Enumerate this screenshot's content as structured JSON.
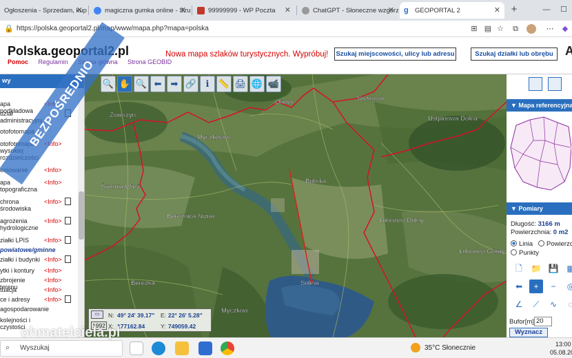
{
  "browser": {
    "tabs": [
      {
        "title": "Ogłoszenia - Sprzedam, kupię -",
        "color": "#2a6fbf"
      },
      {
        "title": "magiczna gumka online - Szuk",
        "color": "#4285f4"
      },
      {
        "title": "99999999 - WP Poczta",
        "color": "#c0392b"
      },
      {
        "title": "ChatGPT - Słoneczne wzgórze",
        "color": "#888888"
      },
      {
        "title": "GEOPORTAL 2",
        "color": "#2a6fbf"
      }
    ],
    "url": "https://polska.geoportal2.pl/map/www/mapa.php?mapa=polska"
  },
  "site": {
    "logo": "Polska.geoportal2.pl",
    "links": [
      "Pomoc",
      "Regulamin",
      "Strona główna",
      "Strona GEOBID"
    ],
    "promo": "Nowa mapa szlaków turystycznych. Wypróbuj!",
    "search_place_btn": "Szukaj miejscowości, ulicy lub adresu",
    "search_parcel_btn": "Szukaj działki lub obrębu"
  },
  "left_panel": {
    "header": "wy",
    "layers": [
      {
        "name": "apa podkładowa",
        "info": "<Info>",
        "doc": false
      },
      {
        "name": "dział administracyjny",
        "info": "",
        "doc": true
      },
      {
        "name": "otofotomapa",
        "info": "",
        "doc": false
      },
      {
        "name": "otofotomapa wysokiej rozdzielczości",
        "info": "<Info>",
        "doc": false
      },
      {
        "name": "eniowanie",
        "info": "<Info>",
        "doc": false
      },
      {
        "name": "apa topograficzna",
        "info": "<Info>",
        "doc": false
      },
      {
        "name": "chrona środowiska",
        "info": "<Info>",
        "doc": true
      },
      {
        "name": "agrożenia hydrologiczne",
        "info": "<Info>",
        "doc": true
      },
      {
        "name": "ziałki LPIS",
        "info": "<Info>",
        "doc": true
      },
      {
        "name": "powiatowe/gminne",
        "info": "",
        "doc": false
      },
      {
        "name": "ziałki i budynki",
        "info": "<Info>",
        "doc": true
      },
      {
        "name": "ytki i kontury",
        "info": "<Info>",
        "doc": false
      },
      {
        "name": "zbrojenie terenu",
        "info": "<Info>",
        "doc": false
      },
      {
        "name": "tuacja",
        "info": "<Info>",
        "doc": false
      },
      {
        "name": "ce i adresy",
        "info": "<Info>",
        "doc": true
      },
      {
        "name": "agospodarowanie",
        "info": "",
        "doc": false
      },
      {
        "name": "kolejności i czystości",
        "info": "",
        "doc": false
      }
    ]
  },
  "map": {
    "places": [
      "Zwierzyń",
      "Orelec",
      "Stefkowa",
      "Ustjanowa Dolna",
      "Myczkowce",
      "Bóbrka",
      "Średnia Wieś",
      "Bereżnica Niżna",
      "Łobozew Dolny",
      "Łobozew Górny",
      "Berezka",
      "Solina",
      "Myczków"
    ],
    "coords": {
      "n_label": "N:",
      "n_val": "49° 24' 39.17\"",
      "e_label": "E:",
      "e_val": "22° 26' 5.28\"",
      "x_label": "X:",
      "x_val": "177162.84",
      "y_label": "Y:",
      "y_val": "749059.42",
      "year": "1992"
    }
  },
  "right_panel": {
    "ref_header": "Mapa referencyjna",
    "meas_header": "Pomiary",
    "length_label": "Długość:",
    "length_val": "3166 m",
    "area_label": "Powierzchnia:",
    "area_val": "0 m2",
    "mode_line": "Linia",
    "mode_area": "Powierzchnia",
    "mode_points": "Punkty",
    "buffer_label": "Bufor[m]",
    "buffer_val": "20",
    "show_btn": "Wyznacz"
  },
  "overlays": {
    "ribbon": "BEZPOŚREDNIO",
    "watermark": "ohmatelciela.pl"
  },
  "taskbar": {
    "search": "Wyszukaj",
    "weather": "35°C  Słonecznie",
    "time": "13:00",
    "date": "05.08.20"
  }
}
